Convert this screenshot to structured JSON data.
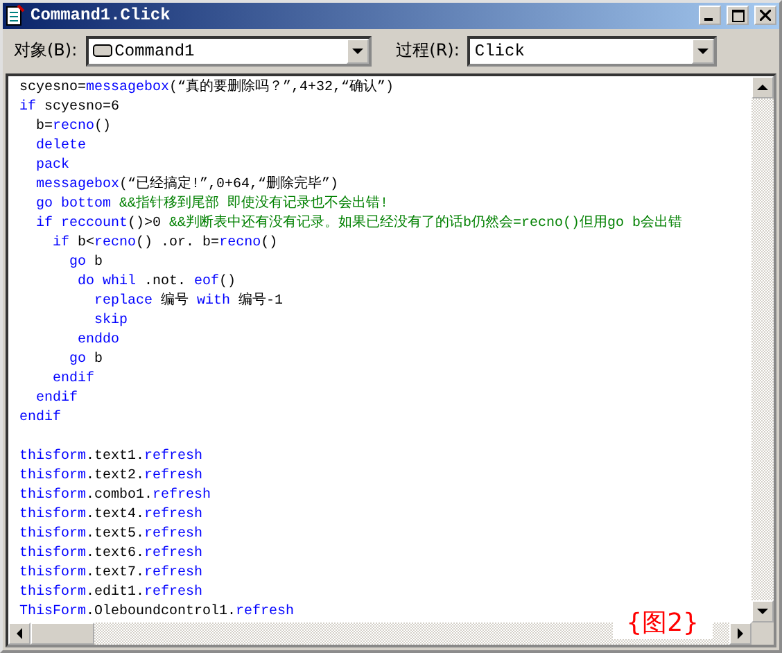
{
  "window": {
    "title": "Command1.Click"
  },
  "object_field": {
    "label": "对象(B):",
    "value": "Command1"
  },
  "procedure_field": {
    "label": "过程(R):",
    "value": "Click"
  },
  "code_blocks": [
    [
      [
        {
          "kind": "plain",
          "text": "scyesno="
        },
        {
          "kind": "keyword",
          "text": "messagebox"
        },
        {
          "kind": "plain",
          "text": "(“真的要删除吗？”,4+32,“确认”)"
        }
      ],
      [
        {
          "kind": "keyword",
          "text": "if"
        },
        {
          "kind": "plain",
          "text": " scyesno=6"
        }
      ],
      [
        {
          "kind": "plain",
          "text": "  b="
        },
        {
          "kind": "keyword",
          "text": "recno"
        },
        {
          "kind": "plain",
          "text": "()"
        }
      ],
      [
        {
          "kind": "keyword",
          "text": "  delete"
        }
      ],
      [
        {
          "kind": "keyword",
          "text": "  pack"
        }
      ],
      [
        {
          "kind": "keyword",
          "text": "  messagebox"
        },
        {
          "kind": "plain",
          "text": "(“已经搞定!”,0+64,“删除完毕”)"
        }
      ],
      [
        {
          "kind": "keyword",
          "text": "  go bottom"
        },
        {
          "kind": "comment",
          "text": " &&指针移到尾部 即使没有记录也不会出错!"
        }
      ],
      [
        {
          "kind": "keyword",
          "text": "  if reccount"
        },
        {
          "kind": "plain",
          "text": "()>0"
        },
        {
          "kind": "comment",
          "text": " &&判断表中还有没有记录。如果已经没有了的话b仍然会=recno()但用go b会出错"
        }
      ],
      [
        {
          "kind": "keyword",
          "text": "    if"
        },
        {
          "kind": "plain",
          "text": " b<"
        },
        {
          "kind": "keyword",
          "text": "recno"
        },
        {
          "kind": "plain",
          "text": "() .or. b="
        },
        {
          "kind": "keyword",
          "text": "recno"
        },
        {
          "kind": "plain",
          "text": "()"
        }
      ],
      [
        {
          "kind": "keyword",
          "text": "      go"
        },
        {
          "kind": "plain",
          "text": " b"
        }
      ],
      [
        {
          "kind": "keyword",
          "text": "       do whil"
        },
        {
          "kind": "plain",
          "text": " .not. "
        },
        {
          "kind": "keyword",
          "text": "eof"
        },
        {
          "kind": "plain",
          "text": "()"
        }
      ],
      [
        {
          "kind": "keyword",
          "text": "         replace"
        },
        {
          "kind": "plain",
          "text": " 编号 "
        },
        {
          "kind": "keyword",
          "text": "with"
        },
        {
          "kind": "plain",
          "text": " 编号-1"
        }
      ],
      [
        {
          "kind": "keyword",
          "text": "         skip"
        }
      ],
      [
        {
          "kind": "keyword",
          "text": "       enddo"
        }
      ],
      [
        {
          "kind": "keyword",
          "text": "      go"
        },
        {
          "kind": "plain",
          "text": " b"
        }
      ],
      [
        {
          "kind": "keyword",
          "text": "    endif"
        }
      ],
      [
        {
          "kind": "keyword",
          "text": "  endif"
        }
      ],
      [
        {
          "kind": "keyword",
          "text": "endif"
        }
      ]
    ],
    [
      [
        {
          "kind": "keyword",
          "text": "thisform"
        },
        {
          "kind": "plain",
          "text": ".text1."
        },
        {
          "kind": "keyword",
          "text": "refresh"
        }
      ],
      [
        {
          "kind": "keyword",
          "text": "thisform"
        },
        {
          "kind": "plain",
          "text": ".text2."
        },
        {
          "kind": "keyword",
          "text": "refresh"
        }
      ],
      [
        {
          "kind": "keyword",
          "text": "thisform"
        },
        {
          "kind": "plain",
          "text": ".combo1."
        },
        {
          "kind": "keyword",
          "text": "refresh"
        }
      ],
      [
        {
          "kind": "keyword",
          "text": "thisform"
        },
        {
          "kind": "plain",
          "text": ".text4."
        },
        {
          "kind": "keyword",
          "text": "refresh"
        }
      ],
      [
        {
          "kind": "keyword",
          "text": "thisform"
        },
        {
          "kind": "plain",
          "text": ".text5."
        },
        {
          "kind": "keyword",
          "text": "refresh"
        }
      ],
      [
        {
          "kind": "keyword",
          "text": "thisform"
        },
        {
          "kind": "plain",
          "text": ".text6."
        },
        {
          "kind": "keyword",
          "text": "refresh"
        }
      ],
      [
        {
          "kind": "keyword",
          "text": "thisform"
        },
        {
          "kind": "plain",
          "text": ".text7."
        },
        {
          "kind": "keyword",
          "text": "refresh"
        }
      ],
      [
        {
          "kind": "keyword",
          "text": "thisform"
        },
        {
          "kind": "plain",
          "text": ".edit1."
        },
        {
          "kind": "keyword",
          "text": "refresh"
        }
      ],
      [
        {
          "kind": "keyword",
          "text": "ThisForm"
        },
        {
          "kind": "plain",
          "text": ".Oleboundcontrol1."
        },
        {
          "kind": "keyword",
          "text": "refresh"
        }
      ]
    ]
  ],
  "figure_label": "{图2}"
}
